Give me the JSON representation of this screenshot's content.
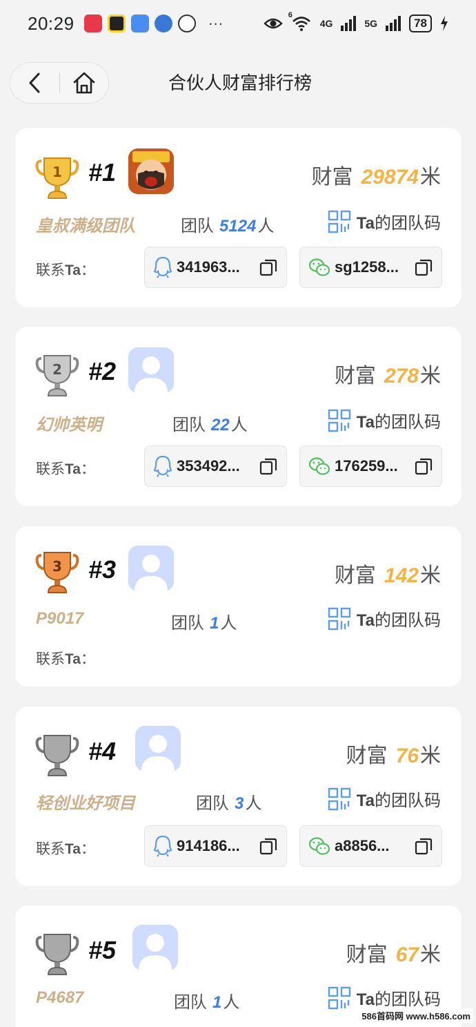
{
  "status_bar": {
    "time": "20:29",
    "battery": "78",
    "net_a": "4G",
    "net_b": "5G",
    "wifi_tag": "6",
    "more": "···"
  },
  "header": {
    "title": "合伙人财富排行榜"
  },
  "labels": {
    "wealth": "财富",
    "wealth_unit": "米",
    "team": "团队",
    "team_unit": "人",
    "qr_prefix": "Ta",
    "qr_suffix": "的团队码",
    "contact_prefix": "联系",
    "contact_ta": "Ta",
    "contact_colon": "："
  },
  "ranking": [
    {
      "rank": "#1",
      "trophy": "gold",
      "avatar": "custom",
      "wealth": "29874",
      "name": "皇叔满级团队",
      "team": "5124",
      "qq": "341963...",
      "wechat": "sg1258..."
    },
    {
      "rank": "#2",
      "trophy": "silver",
      "avatar": "default",
      "wealth": "278",
      "name": "幻帅英明",
      "team": "22",
      "qq": "353492...",
      "wechat": "176259..."
    },
    {
      "rank": "#3",
      "trophy": "bronze",
      "avatar": "default",
      "wealth": "142",
      "name": "P9017",
      "team": "1",
      "qq": "",
      "wechat": ""
    },
    {
      "rank": "#4",
      "trophy": "gray",
      "avatar": "default",
      "wealth": "76",
      "name": "轻创业好项目",
      "team": "3",
      "qq": "914186...",
      "wechat": "a8856..."
    },
    {
      "rank": "#5",
      "trophy": "gray",
      "avatar": "default",
      "wealth": "67",
      "name": "P4687",
      "team": "1",
      "qq": "",
      "wechat": ""
    }
  ],
  "watermark": "586首码网 www.h586.com",
  "colors": {
    "wealth": "#f5b341",
    "team": "#3b7df0",
    "name": "#cdb088",
    "qq_icon": "#5b9bf0",
    "wechat_icon": "#4cc25a"
  }
}
